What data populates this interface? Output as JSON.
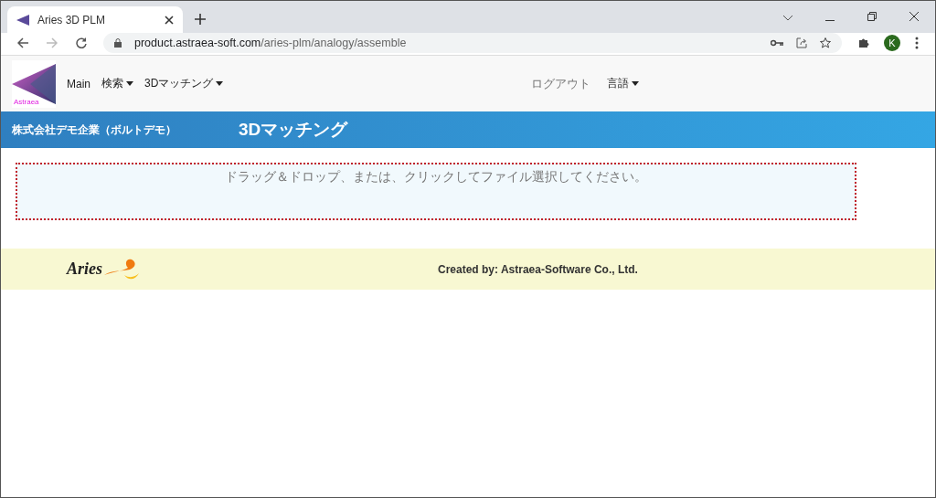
{
  "browser": {
    "tab_title": "Aries 3D PLM",
    "url_host": "product.astraea-soft.com",
    "url_path": "/aries-plm/analogy/assemble",
    "avatar": "K"
  },
  "navbar": {
    "logo_text": "Astraea",
    "items": [
      {
        "label": "Main",
        "dropdown": false,
        "muted": false
      },
      {
        "label": "検索",
        "dropdown": true,
        "muted": false
      },
      {
        "label": "3Dマッチング",
        "dropdown": true,
        "muted": false
      }
    ],
    "right_items": [
      {
        "label": "ログアウト",
        "dropdown": false,
        "muted": true
      },
      {
        "label": "言語",
        "dropdown": true,
        "muted": false
      }
    ]
  },
  "header": {
    "company": "株式会社デモ企業（ボルトデモ）",
    "title": "3Dマッチング"
  },
  "drop_zone": {
    "text": "ドラッグ＆ドロップ、または、クリックしてファイル選択してください。"
  },
  "footer": {
    "logo_text": "Aries",
    "credit": "Created by: Astraea-Software Co., Ltd."
  }
}
